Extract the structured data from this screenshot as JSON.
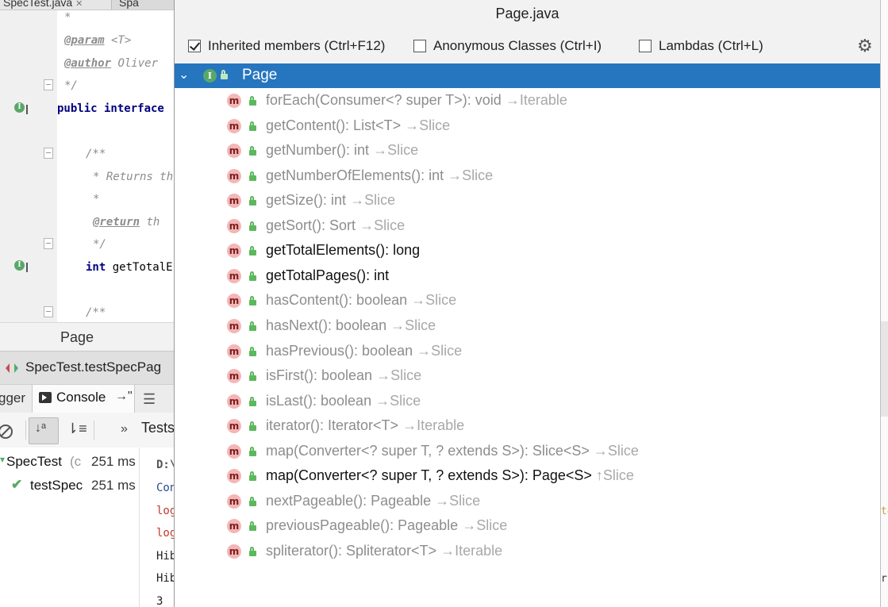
{
  "editor": {
    "tabs": [
      "SpecTest.java",
      "Spa"
    ],
    "lines": [
      {
        "kind": "comment",
        "text": "*"
      },
      {
        "kind": "comment-tag",
        "tag": "@param",
        "rest": " <T>"
      },
      {
        "kind": "comment-tag",
        "tag": "@author",
        "rest": " Oliver"
      },
      {
        "kind": "comment",
        "text": "*/"
      },
      {
        "kind": "code",
        "keyword": "public interface",
        "rest": ""
      },
      {
        "kind": "comment",
        "text": "/**"
      },
      {
        "kind": "comment",
        "text": "* Returns th"
      },
      {
        "kind": "comment",
        "text": "*"
      },
      {
        "kind": "comment-tag",
        "tag": "@return",
        "rest": " th"
      },
      {
        "kind": "comment",
        "text": "*/"
      },
      {
        "kind": "code",
        "keyword": "int",
        "rest": " getTotalE"
      },
      {
        "kind": "comment",
        "text": "/**"
      }
    ],
    "breadcrumb": "Page"
  },
  "run_panel": {
    "title": "SpecTest.testSpecPag",
    "tab_debugger": "gger",
    "tab_console": "Console",
    "tests_label": "Tests",
    "tree": [
      {
        "name": "SpecTest",
        "suffix": "(c",
        "time": "251 ms"
      },
      {
        "name": "testSpec",
        "suffix": "",
        "time": "251 ms"
      }
    ],
    "console_lines": [
      "D:\\",
      "Con",
      "log",
      "log",
      "Hib",
      "Hib",
      "3"
    ]
  },
  "right_edge": {
    "fragments": [
      "t4",
      "r("
    ]
  },
  "popup": {
    "title": "Page.java",
    "options": [
      {
        "label": "Inherited members (Ctrl+F12)",
        "checked": true
      },
      {
        "label": "Anonymous Classes (Ctrl+I)",
        "checked": false
      },
      {
        "label": "Lambdas (Ctrl+L)",
        "checked": false
      }
    ],
    "root": {
      "name": "Page",
      "badge": "I"
    },
    "member_badge": "m",
    "members": [
      {
        "sig": "forEach(Consumer<? super T>): void",
        "arrow": "→",
        "source": "Iterable",
        "inherited": true
      },
      {
        "sig": "getContent(): List<T>",
        "arrow": "→",
        "source": "Slice",
        "inherited": true
      },
      {
        "sig": "getNumber(): int",
        "arrow": "→",
        "source": "Slice",
        "inherited": true
      },
      {
        "sig": "getNumberOfElements(): int",
        "arrow": "→",
        "source": "Slice",
        "inherited": true
      },
      {
        "sig": "getSize(): int",
        "arrow": "→",
        "source": "Slice",
        "inherited": true
      },
      {
        "sig": "getSort(): Sort",
        "arrow": "→",
        "source": "Slice",
        "inherited": true
      },
      {
        "sig": "getTotalElements(): long",
        "arrow": "",
        "source": "",
        "inherited": false
      },
      {
        "sig": "getTotalPages(): int",
        "arrow": "",
        "source": "",
        "inherited": false
      },
      {
        "sig": "hasContent(): boolean",
        "arrow": "→",
        "source": "Slice",
        "inherited": true
      },
      {
        "sig": "hasNext(): boolean",
        "arrow": "→",
        "source": "Slice",
        "inherited": true
      },
      {
        "sig": "hasPrevious(): boolean",
        "arrow": "→",
        "source": "Slice",
        "inherited": true
      },
      {
        "sig": "isFirst(): boolean",
        "arrow": "→",
        "source": "Slice",
        "inherited": true
      },
      {
        "sig": "isLast(): boolean",
        "arrow": "→",
        "source": "Slice",
        "inherited": true
      },
      {
        "sig": "iterator(): Iterator<T>",
        "arrow": "→",
        "source": "Iterable",
        "inherited": true
      },
      {
        "sig": "map(Converter<? super T, ? extends S>): Slice<S>",
        "arrow": "→",
        "source": "Slice",
        "inherited": true
      },
      {
        "sig": "map(Converter<? super T, ? extends S>): Page<S>",
        "arrow": "↑",
        "source": "Slice",
        "inherited": false
      },
      {
        "sig": "nextPageable(): Pageable",
        "arrow": "→",
        "source": "Slice",
        "inherited": true
      },
      {
        "sig": "previousPageable(): Pageable",
        "arrow": "→",
        "source": "Slice",
        "inherited": true
      },
      {
        "sig": "spliterator(): Spliterator<T>",
        "arrow": "→",
        "source": "Iterable",
        "inherited": true
      }
    ]
  }
}
